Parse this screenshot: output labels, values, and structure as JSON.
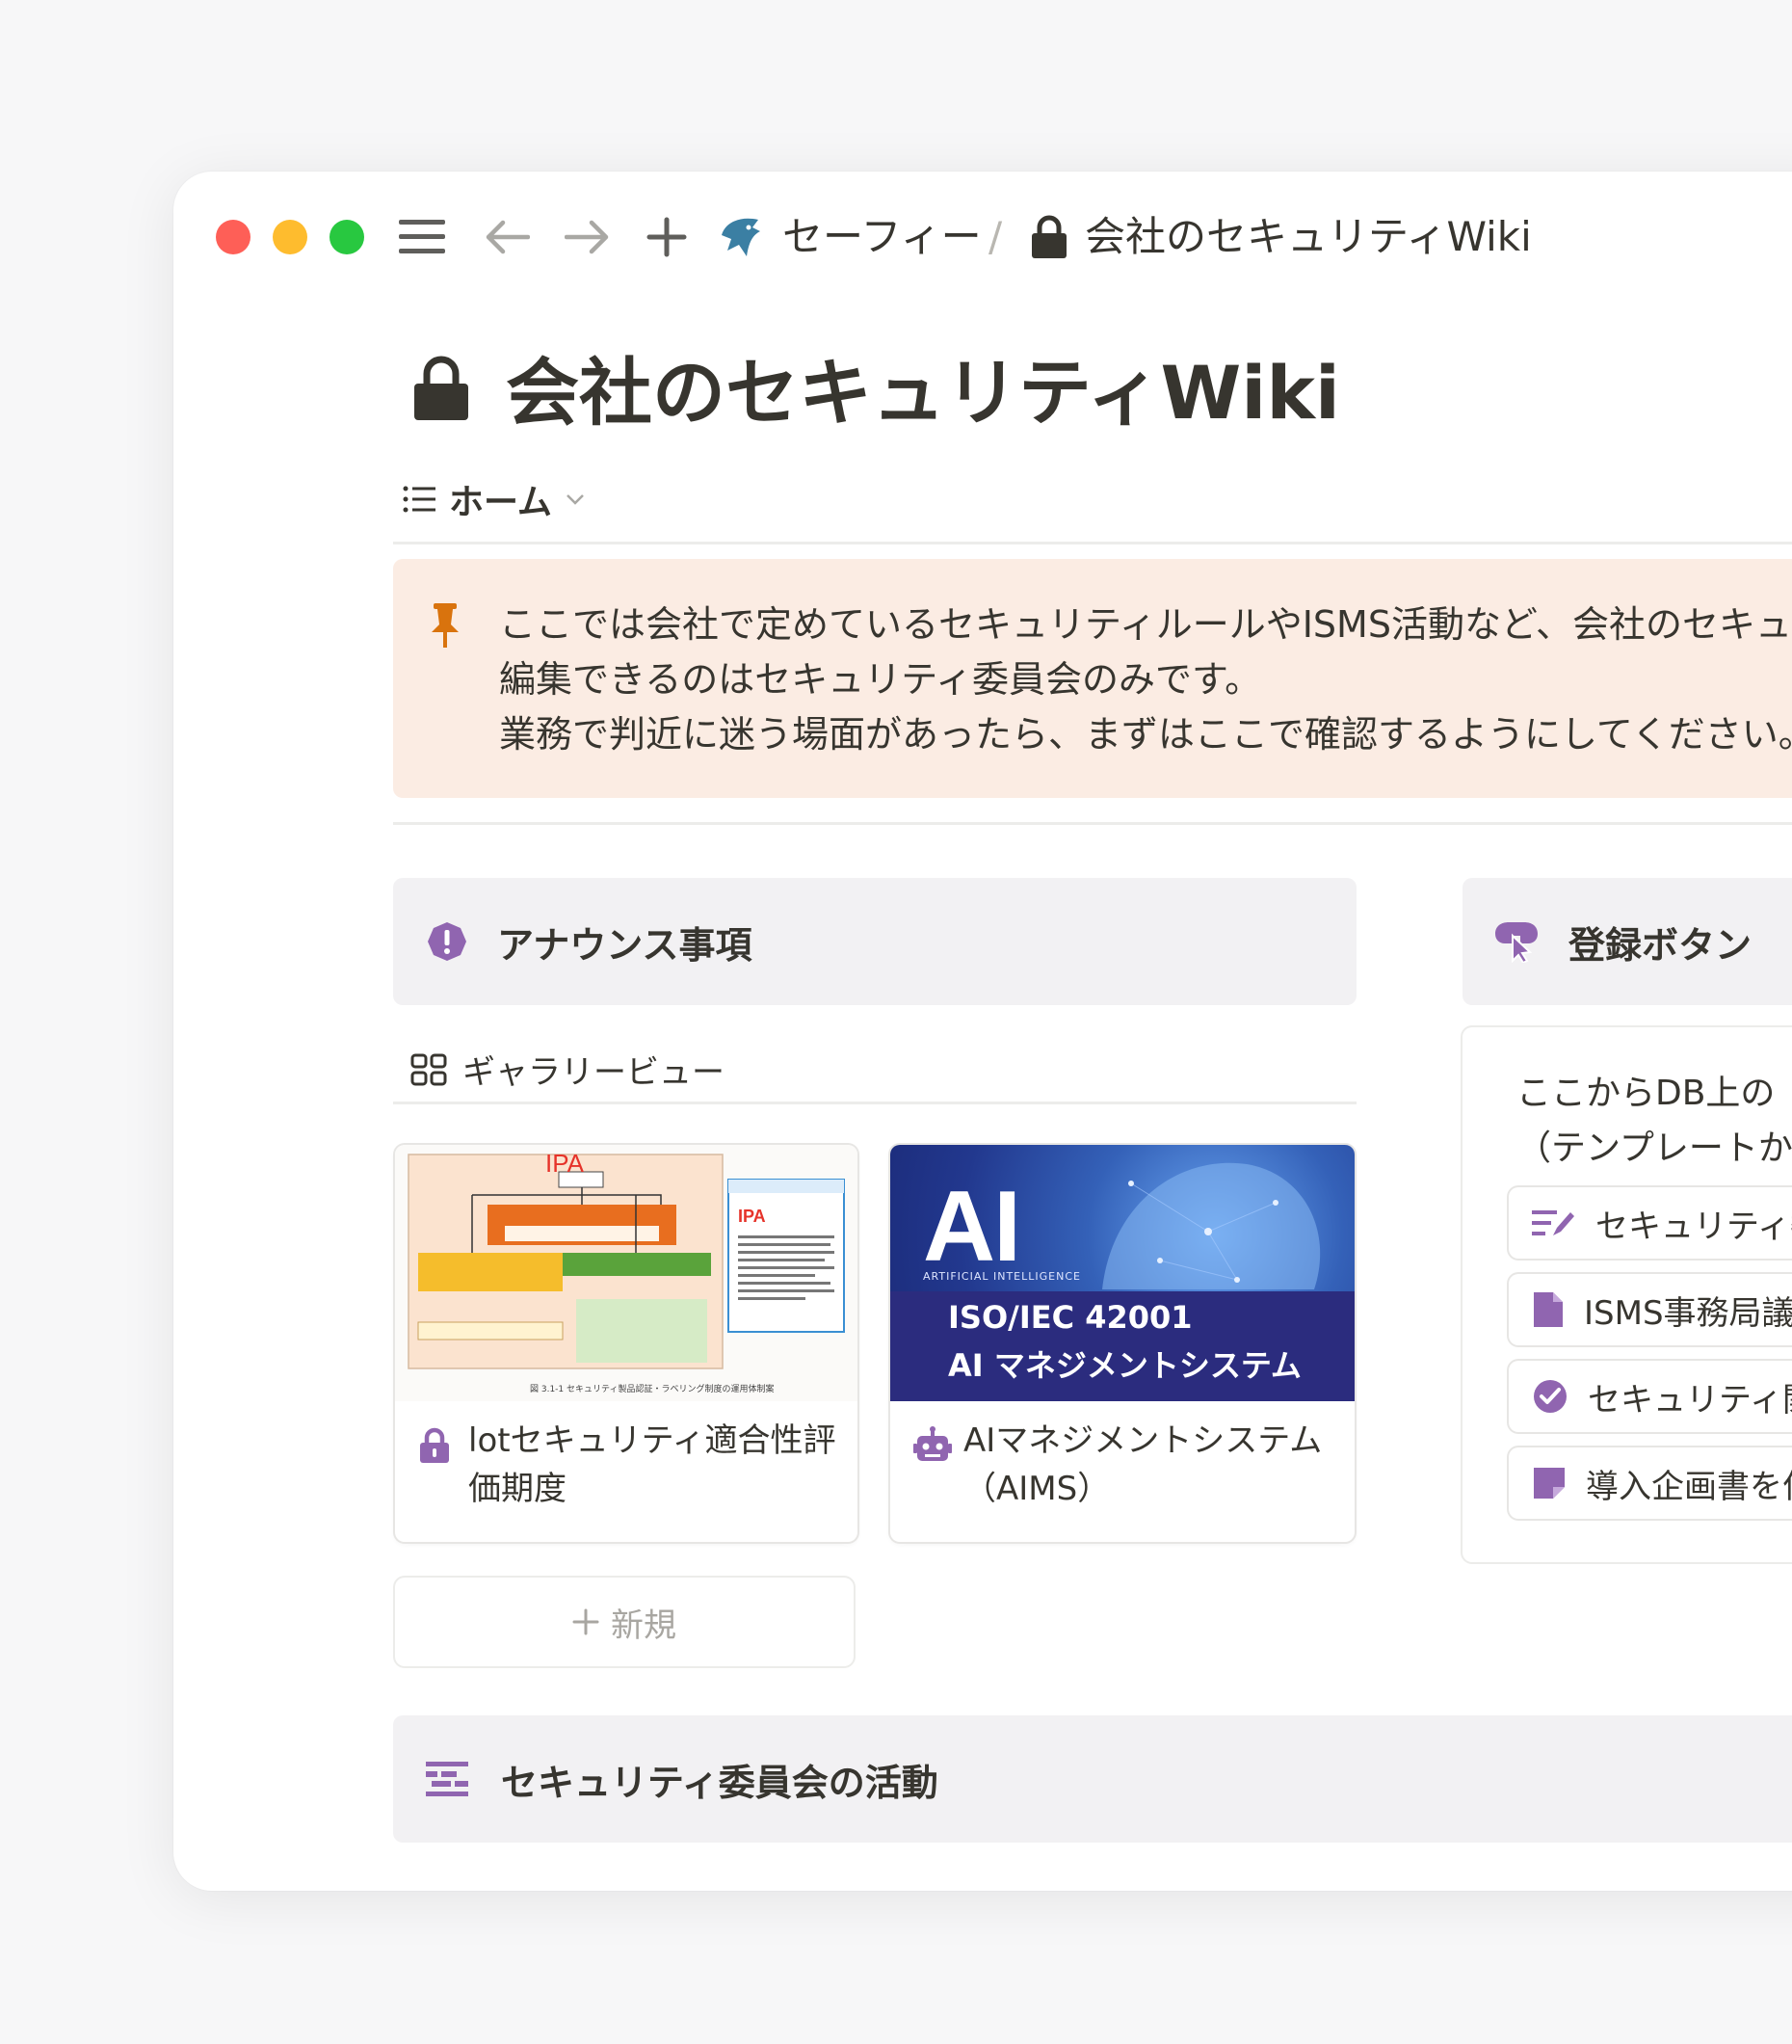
{
  "breadcrumb": {
    "workspace": "セーフィー",
    "separator": "/",
    "page": "会社のセキュリティWiki"
  },
  "page": {
    "title": "会社のセキュリティWiki"
  },
  "tabs": {
    "active_label": "ホーム"
  },
  "callout": {
    "lines": [
      "ここでは会社で定めているセキュリティルールやISMS活動など、会社のセキュ",
      "編集できるのはセキュリティ委員会のみです。",
      "業務で判近に迷う場面があったら、まずはここで確認するようにしてください。"
    ]
  },
  "announcements": {
    "header": "アナウンス事項",
    "view_label": "ギャラリービュー",
    "cards": [
      {
        "title": "lotセキュリティ適合性評価期度",
        "cover": {
          "logo": "IPA",
          "caption": "図 3.1-1 セキュリティ製品認証・ラベリング制度の運用体制案"
        }
      },
      {
        "title": "AIマネジメントシステム（AIMS）",
        "cover": {
          "big": "AI",
          "small": "ARTIFICIAL INTELLIGENCE",
          "line1": "ISO/IEC 42001",
          "line2": "AI マネジメントシステム"
        }
      }
    ],
    "new_label": "新規"
  },
  "registration": {
    "header": "登録ボタン",
    "intro_lines": [
      "ここからDB上の",
      "（テンプレートか"
    ],
    "buttons": [
      {
        "label": "セキュリティ委"
      },
      {
        "label": "ISMS事務局議"
      },
      {
        "label": "セキュリティ関"
      },
      {
        "label": "導入企画書を作"
      }
    ]
  },
  "committee": {
    "header": "セキュリティ委員会の活動"
  },
  "colors": {
    "accent_purple": "#9065b0",
    "callout_bg": "#fbece3",
    "pin_orange": "#d9730d"
  }
}
